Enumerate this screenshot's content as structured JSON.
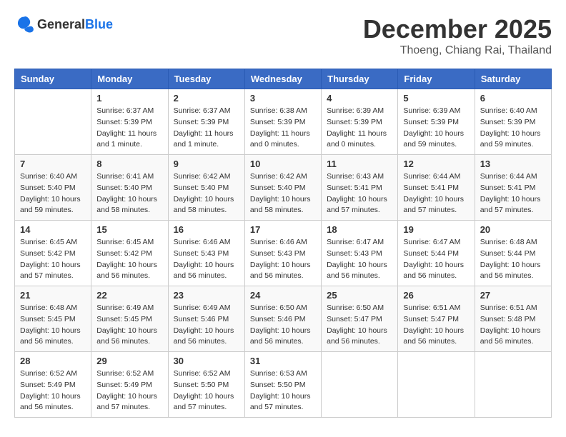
{
  "header": {
    "logo_general": "General",
    "logo_blue": "Blue",
    "month_year": "December 2025",
    "location": "Thoeng, Chiang Rai, Thailand"
  },
  "weekdays": [
    "Sunday",
    "Monday",
    "Tuesday",
    "Wednesday",
    "Thursday",
    "Friday",
    "Saturday"
  ],
  "weeks": [
    [
      {
        "day": "",
        "sunrise": "",
        "sunset": "",
        "daylight": ""
      },
      {
        "day": "1",
        "sunrise": "Sunrise: 6:37 AM",
        "sunset": "Sunset: 5:39 PM",
        "daylight": "Daylight: 11 hours and 1 minute."
      },
      {
        "day": "2",
        "sunrise": "Sunrise: 6:37 AM",
        "sunset": "Sunset: 5:39 PM",
        "daylight": "Daylight: 11 hours and 1 minute."
      },
      {
        "day": "3",
        "sunrise": "Sunrise: 6:38 AM",
        "sunset": "Sunset: 5:39 PM",
        "daylight": "Daylight: 11 hours and 0 minutes."
      },
      {
        "day": "4",
        "sunrise": "Sunrise: 6:39 AM",
        "sunset": "Sunset: 5:39 PM",
        "daylight": "Daylight: 11 hours and 0 minutes."
      },
      {
        "day": "5",
        "sunrise": "Sunrise: 6:39 AM",
        "sunset": "Sunset: 5:39 PM",
        "daylight": "Daylight: 10 hours and 59 minutes."
      },
      {
        "day": "6",
        "sunrise": "Sunrise: 6:40 AM",
        "sunset": "Sunset: 5:39 PM",
        "daylight": "Daylight: 10 hours and 59 minutes."
      }
    ],
    [
      {
        "day": "7",
        "sunrise": "Sunrise: 6:40 AM",
        "sunset": "Sunset: 5:40 PM",
        "daylight": "Daylight: 10 hours and 59 minutes."
      },
      {
        "day": "8",
        "sunrise": "Sunrise: 6:41 AM",
        "sunset": "Sunset: 5:40 PM",
        "daylight": "Daylight: 10 hours and 58 minutes."
      },
      {
        "day": "9",
        "sunrise": "Sunrise: 6:42 AM",
        "sunset": "Sunset: 5:40 PM",
        "daylight": "Daylight: 10 hours and 58 minutes."
      },
      {
        "day": "10",
        "sunrise": "Sunrise: 6:42 AM",
        "sunset": "Sunset: 5:40 PM",
        "daylight": "Daylight: 10 hours and 58 minutes."
      },
      {
        "day": "11",
        "sunrise": "Sunrise: 6:43 AM",
        "sunset": "Sunset: 5:41 PM",
        "daylight": "Daylight: 10 hours and 57 minutes."
      },
      {
        "day": "12",
        "sunrise": "Sunrise: 6:44 AM",
        "sunset": "Sunset: 5:41 PM",
        "daylight": "Daylight: 10 hours and 57 minutes."
      },
      {
        "day": "13",
        "sunrise": "Sunrise: 6:44 AM",
        "sunset": "Sunset: 5:41 PM",
        "daylight": "Daylight: 10 hours and 57 minutes."
      }
    ],
    [
      {
        "day": "14",
        "sunrise": "Sunrise: 6:45 AM",
        "sunset": "Sunset: 5:42 PM",
        "daylight": "Daylight: 10 hours and 57 minutes."
      },
      {
        "day": "15",
        "sunrise": "Sunrise: 6:45 AM",
        "sunset": "Sunset: 5:42 PM",
        "daylight": "Daylight: 10 hours and 56 minutes."
      },
      {
        "day": "16",
        "sunrise": "Sunrise: 6:46 AM",
        "sunset": "Sunset: 5:43 PM",
        "daylight": "Daylight: 10 hours and 56 minutes."
      },
      {
        "day": "17",
        "sunrise": "Sunrise: 6:46 AM",
        "sunset": "Sunset: 5:43 PM",
        "daylight": "Daylight: 10 hours and 56 minutes."
      },
      {
        "day": "18",
        "sunrise": "Sunrise: 6:47 AM",
        "sunset": "Sunset: 5:43 PM",
        "daylight": "Daylight: 10 hours and 56 minutes."
      },
      {
        "day": "19",
        "sunrise": "Sunrise: 6:47 AM",
        "sunset": "Sunset: 5:44 PM",
        "daylight": "Daylight: 10 hours and 56 minutes."
      },
      {
        "day": "20",
        "sunrise": "Sunrise: 6:48 AM",
        "sunset": "Sunset: 5:44 PM",
        "daylight": "Daylight: 10 hours and 56 minutes."
      }
    ],
    [
      {
        "day": "21",
        "sunrise": "Sunrise: 6:48 AM",
        "sunset": "Sunset: 5:45 PM",
        "daylight": "Daylight: 10 hours and 56 minutes."
      },
      {
        "day": "22",
        "sunrise": "Sunrise: 6:49 AM",
        "sunset": "Sunset: 5:45 PM",
        "daylight": "Daylight: 10 hours and 56 minutes."
      },
      {
        "day": "23",
        "sunrise": "Sunrise: 6:49 AM",
        "sunset": "Sunset: 5:46 PM",
        "daylight": "Daylight: 10 hours and 56 minutes."
      },
      {
        "day": "24",
        "sunrise": "Sunrise: 6:50 AM",
        "sunset": "Sunset: 5:46 PM",
        "daylight": "Daylight: 10 hours and 56 minutes."
      },
      {
        "day": "25",
        "sunrise": "Sunrise: 6:50 AM",
        "sunset": "Sunset: 5:47 PM",
        "daylight": "Daylight: 10 hours and 56 minutes."
      },
      {
        "day": "26",
        "sunrise": "Sunrise: 6:51 AM",
        "sunset": "Sunset: 5:47 PM",
        "daylight": "Daylight: 10 hours and 56 minutes."
      },
      {
        "day": "27",
        "sunrise": "Sunrise: 6:51 AM",
        "sunset": "Sunset: 5:48 PM",
        "daylight": "Daylight: 10 hours and 56 minutes."
      }
    ],
    [
      {
        "day": "28",
        "sunrise": "Sunrise: 6:52 AM",
        "sunset": "Sunset: 5:49 PM",
        "daylight": "Daylight: 10 hours and 56 minutes."
      },
      {
        "day": "29",
        "sunrise": "Sunrise: 6:52 AM",
        "sunset": "Sunset: 5:49 PM",
        "daylight": "Daylight: 10 hours and 57 minutes."
      },
      {
        "day": "30",
        "sunrise": "Sunrise: 6:52 AM",
        "sunset": "Sunset: 5:50 PM",
        "daylight": "Daylight: 10 hours and 57 minutes."
      },
      {
        "day": "31",
        "sunrise": "Sunrise: 6:53 AM",
        "sunset": "Sunset: 5:50 PM",
        "daylight": "Daylight: 10 hours and 57 minutes."
      },
      {
        "day": "",
        "sunrise": "",
        "sunset": "",
        "daylight": ""
      },
      {
        "day": "",
        "sunrise": "",
        "sunset": "",
        "daylight": ""
      },
      {
        "day": "",
        "sunrise": "",
        "sunset": "",
        "daylight": ""
      }
    ]
  ]
}
